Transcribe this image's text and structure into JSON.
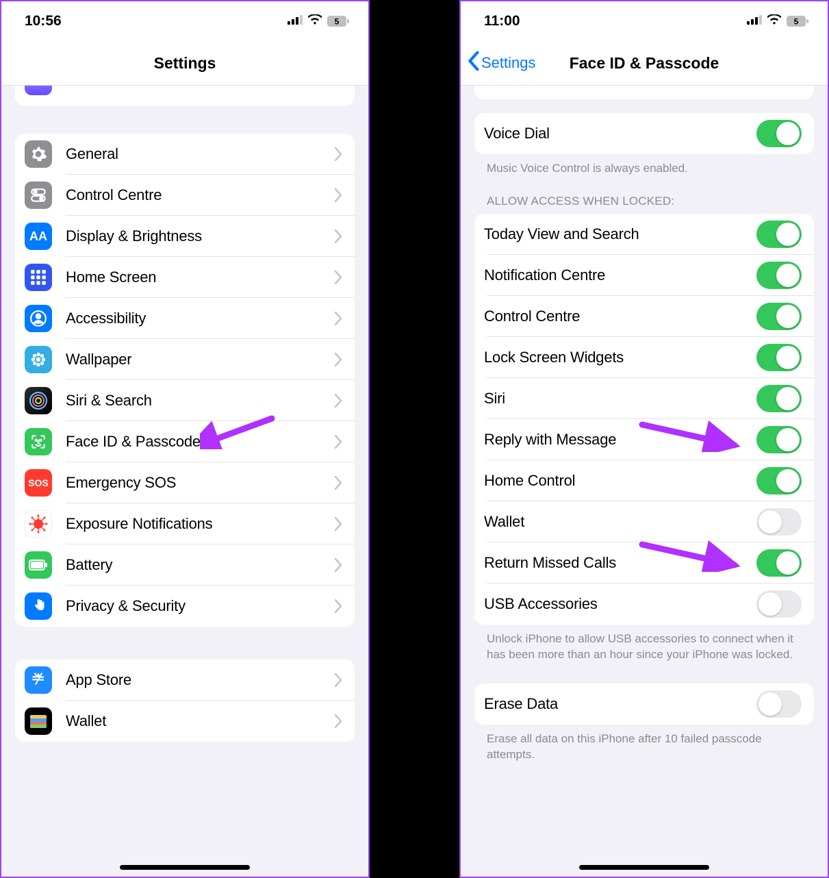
{
  "left": {
    "status_time": "10:56",
    "battery_level": "5",
    "title": "Settings",
    "group1": [
      {
        "name": "general",
        "label": "General",
        "icon": "gear",
        "bg": "bg-grey"
      },
      {
        "name": "control-centre",
        "label": "Control Centre",
        "icon": "toggles",
        "bg": "bg-grey"
      },
      {
        "name": "display",
        "label": "Display & Brightness",
        "icon": "AA",
        "bg": "bg-blue"
      },
      {
        "name": "home-screen",
        "label": "Home Screen",
        "icon": "grid",
        "bg": "bg-indigo"
      },
      {
        "name": "accessibility",
        "label": "Accessibility",
        "icon": "person",
        "bg": "bg-blue"
      },
      {
        "name": "wallpaper",
        "label": "Wallpaper",
        "icon": "flower",
        "bg": "bg-cyan"
      },
      {
        "name": "siri",
        "label": "Siri & Search",
        "icon": "siri",
        "bg": "bg-siri"
      },
      {
        "name": "faceid",
        "label": "Face ID & Passcode",
        "icon": "face",
        "bg": "bg-green"
      },
      {
        "name": "sos",
        "label": "Emergency SOS",
        "icon": "SOS",
        "bg": "bg-red"
      },
      {
        "name": "exposure",
        "label": "Exposure Notifications",
        "icon": "virus",
        "bg": "bg-redlight"
      },
      {
        "name": "battery",
        "label": "Battery",
        "icon": "battery",
        "bg": "bg-green"
      },
      {
        "name": "privacy",
        "label": "Privacy & Security",
        "icon": "hand",
        "bg": "bg-blue"
      }
    ],
    "group2": [
      {
        "name": "app-store",
        "label": "App Store",
        "icon": "appstore",
        "bg": "bg-app"
      },
      {
        "name": "wallet",
        "label": "Wallet",
        "icon": "wallet",
        "bg": "bg-wallet"
      }
    ]
  },
  "right": {
    "status_time": "11:00",
    "battery_level": "5",
    "back_label": "Settings",
    "title": "Face ID & Passcode",
    "voice_dial": {
      "label": "Voice Dial",
      "on": true
    },
    "voice_dial_footer": "Music Voice Control is always enabled.",
    "allow_header": "ALLOW ACCESS WHEN LOCKED:",
    "allow_items": [
      {
        "name": "today-view",
        "label": "Today View and Search",
        "on": true
      },
      {
        "name": "notification-centre",
        "label": "Notification Centre",
        "on": true
      },
      {
        "name": "control-centre",
        "label": "Control Centre",
        "on": true
      },
      {
        "name": "lock-widgets",
        "label": "Lock Screen Widgets",
        "on": true
      },
      {
        "name": "siri",
        "label": "Siri",
        "on": true
      },
      {
        "name": "reply-message",
        "label": "Reply with Message",
        "on": true
      },
      {
        "name": "home-control",
        "label": "Home Control",
        "on": true
      },
      {
        "name": "wallet",
        "label": "Wallet",
        "on": false
      },
      {
        "name": "return-missed",
        "label": "Return Missed Calls",
        "on": true
      },
      {
        "name": "usb",
        "label": "USB Accessories",
        "on": false
      }
    ],
    "usb_footer": "Unlock iPhone to allow USB accessories to connect when it has been more than an hour since your iPhone was locked.",
    "erase": {
      "label": "Erase Data",
      "on": false
    },
    "erase_footer": "Erase all data on this iPhone after 10 failed passcode attempts."
  }
}
